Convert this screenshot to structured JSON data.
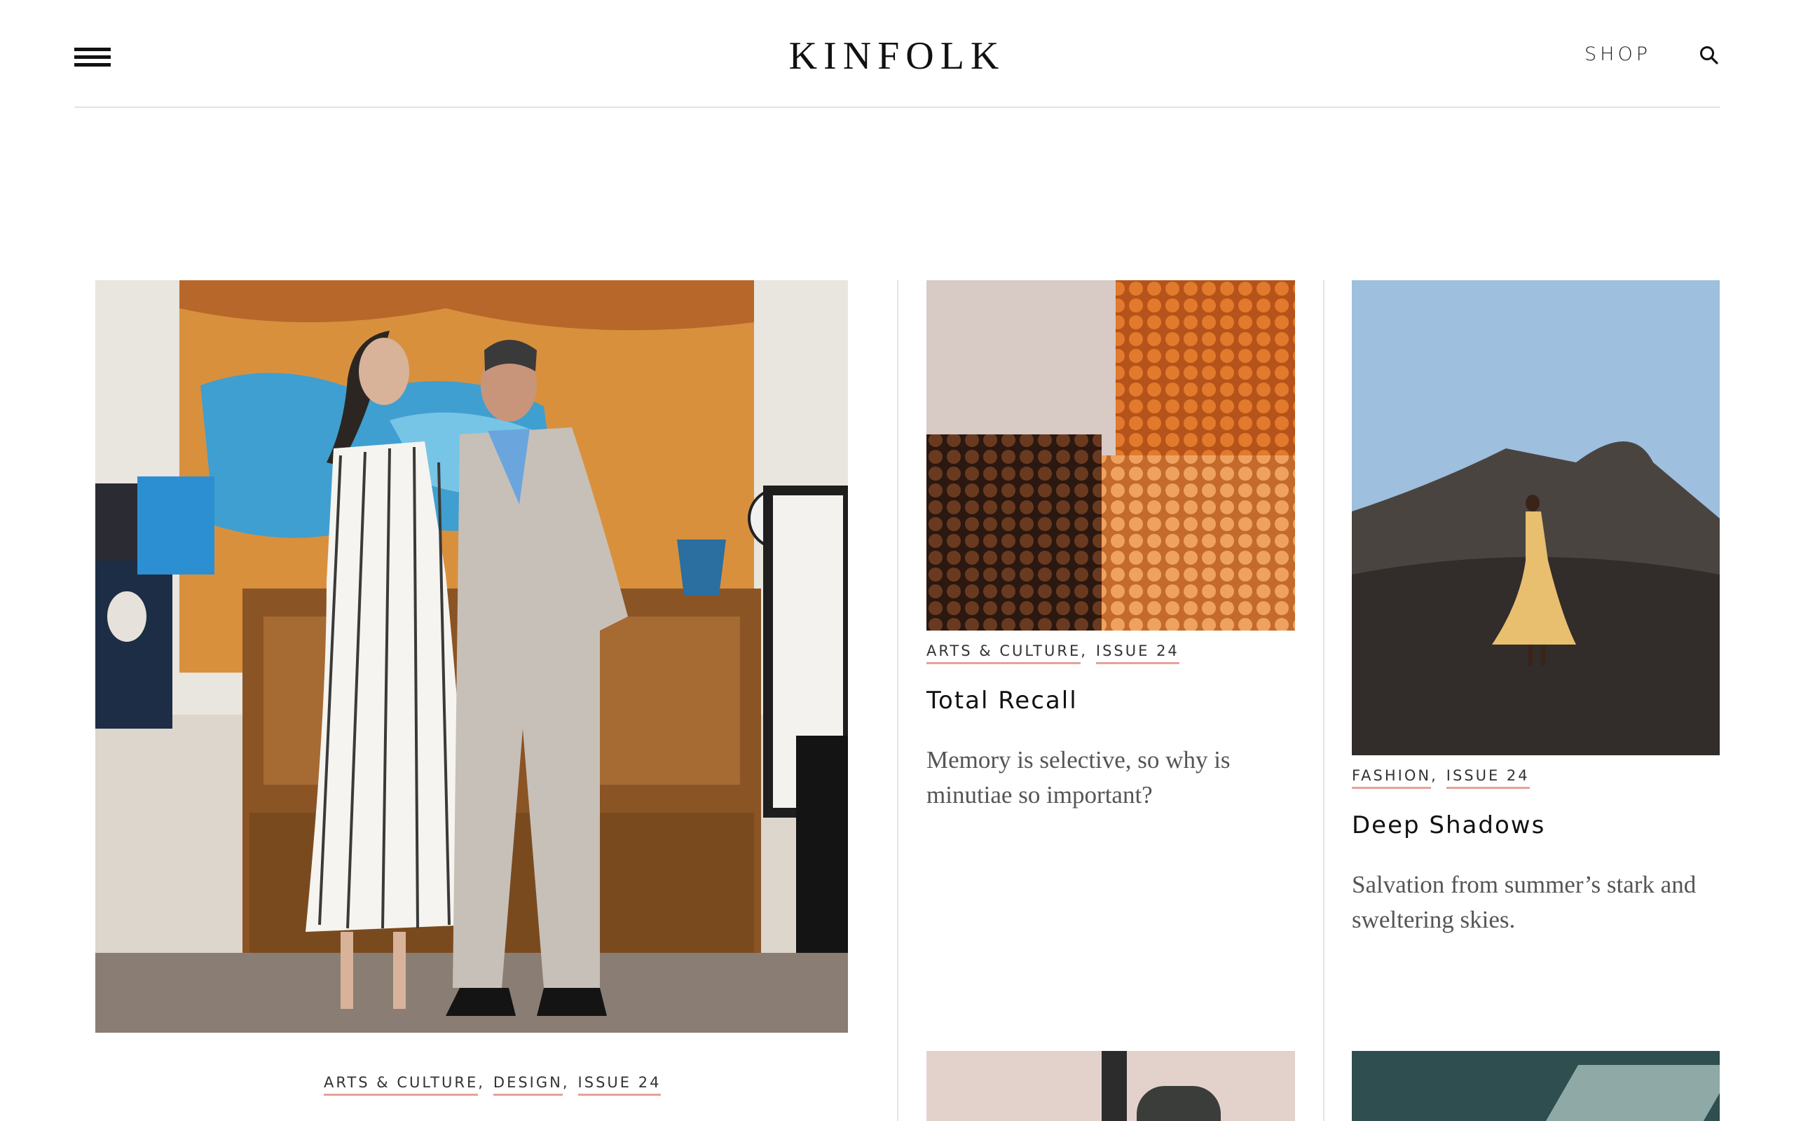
{
  "header": {
    "logo": "KINFOLK",
    "shop_label": "SHOP"
  },
  "articles": [
    {
      "image": "portrait of a couple posing in front of a painting and carved cabinet",
      "tags": [
        "ARTS & CULTURE",
        "DESIGN",
        "ISSUE 24"
      ]
    },
    {
      "image": "close-up of orange and brown mosaic tiles",
      "tags": [
        "ARTS & CULTURE",
        "ISSUE 24"
      ],
      "title": "Total Recall",
      "description": "Memory is selective, so why is minutiae so important?"
    },
    {
      "image": "woman in yellow dress on a dark volcanic hillside",
      "tags": [
        "FASHION",
        "ISSUE 24"
      ],
      "title": "Deep Shadows",
      "description": "Salvation from summer’s stark and sweltering skies."
    }
  ],
  "colors": {
    "tag_underline": "#e8a19a",
    "rule": "#e2e2e2"
  }
}
